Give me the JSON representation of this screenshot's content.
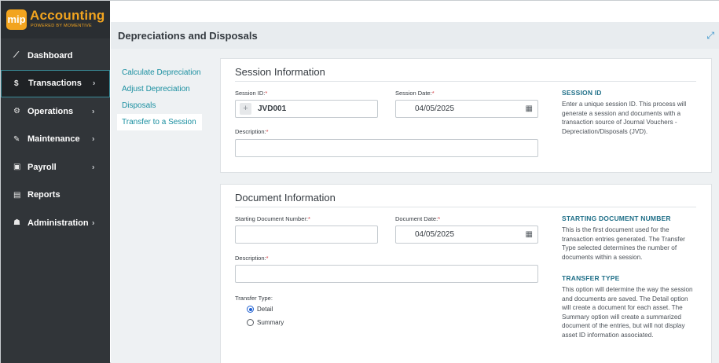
{
  "app": {
    "logo_badge": "mip",
    "logo_title": "Accounting",
    "logo_sub": "POWERED BY MOMENTIVE"
  },
  "nav": [
    {
      "label": "Dashboard",
      "icon": "chart-line-icon",
      "glyph": "⟋"
    },
    {
      "label": "Transactions",
      "icon": "dollar-icon",
      "glyph": "$",
      "chevron": "›"
    },
    {
      "label": "Operations",
      "icon": "gears-icon",
      "glyph": "⚙",
      "chevron": "›"
    },
    {
      "label": "Maintenance",
      "icon": "wrench-icon",
      "glyph": "✎",
      "chevron": "›"
    },
    {
      "label": "Payroll",
      "icon": "money-icon",
      "glyph": "▣",
      "chevron": "›"
    },
    {
      "label": "Reports",
      "icon": "document-icon",
      "glyph": "▤"
    },
    {
      "label": "Administration",
      "icon": "users-icon",
      "glyph": "☗",
      "chevron": "›"
    }
  ],
  "header": {
    "title": "Depreciations and Disposals",
    "expand_glyph": "⤢"
  },
  "subnav": [
    {
      "label": "Calculate Depreciation"
    },
    {
      "label": "Adjust Depreciation"
    },
    {
      "label": "Disposals"
    },
    {
      "label": "Transfer to a Session"
    }
  ],
  "session": {
    "title": "Session Information",
    "id_label": "Session ID:",
    "id_value": "JVD001",
    "date_label": "Session Date:",
    "date_value": "04/05/2025",
    "desc_label": "Description:",
    "desc_value": "",
    "required_mark": "*",
    "help_head": "SESSION ID",
    "help_text": "Enter a unique session ID. This process will generate a session and documents with a transaction source of Journal Vouchers - Depreciation/Disposals (JVD)."
  },
  "document": {
    "title": "Document Information",
    "start_label": "Starting Document Number:",
    "start_value": "",
    "date_label": "Document Date:",
    "date_value": "04/05/2025",
    "desc_label": "Description:",
    "desc_value": "",
    "transfer_label": "Transfer Type:",
    "opt_detail": "Detail",
    "opt_summary": "Summary",
    "help_head1": "STARTING DOCUMENT NUMBER",
    "help_text1": "This is the first document used for the transaction entries generated. The Transfer Type selected determines the number of documents within a session.",
    "help_head2": "TRANSFER TYPE",
    "help_text2": "This option will determine the way the session and documents are saved. The Detail option will create a document for each asset. The Summary option will create a summarized document of the entries, but will not display asset ID information associated."
  },
  "colors": {
    "sidebar": "#313539",
    "accent": "#f2a41f",
    "link": "#1a8fa0",
    "required": "#d0393e"
  }
}
